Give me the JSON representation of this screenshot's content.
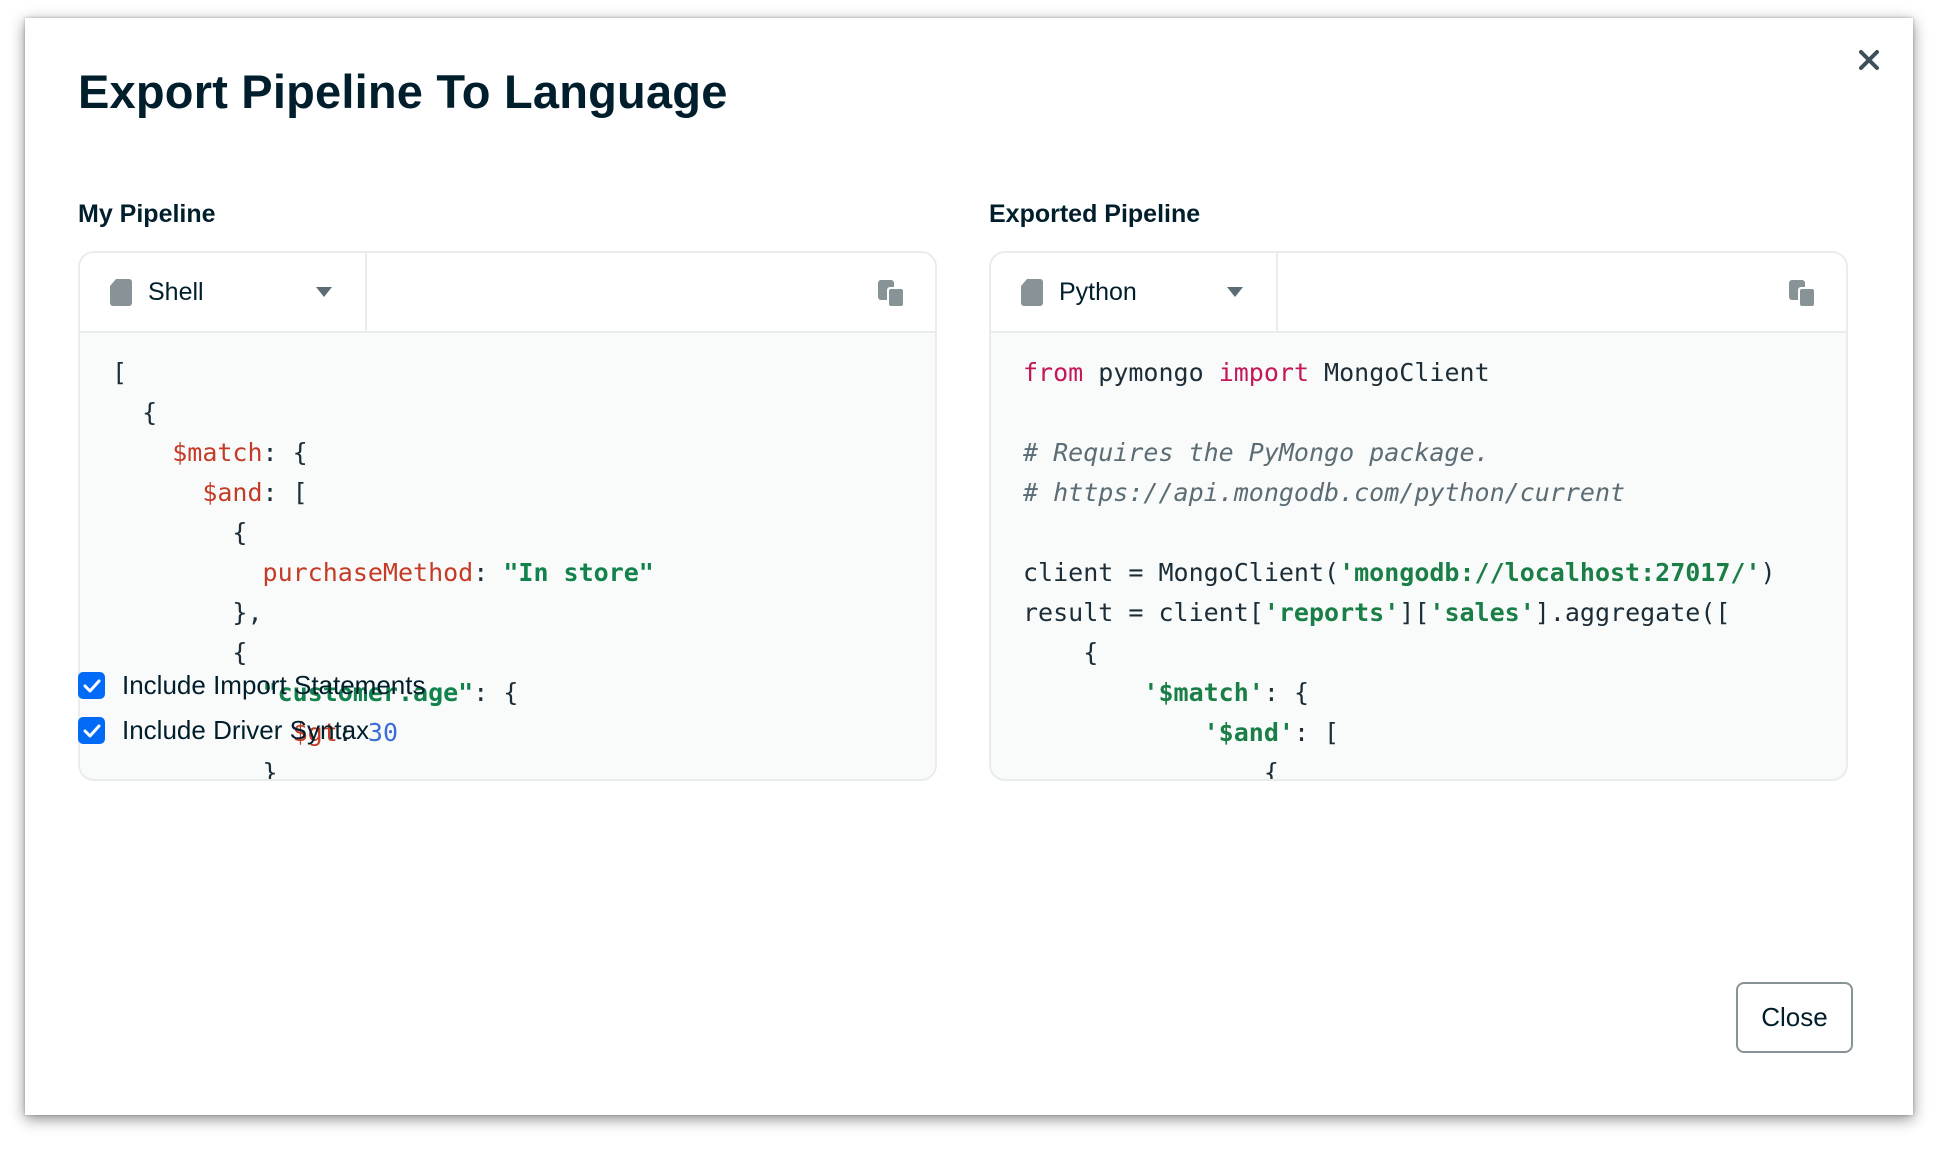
{
  "modal": {
    "title": "Export Pipeline To Language",
    "close_icon": "close-icon"
  },
  "left_panel": {
    "label": "My Pipeline",
    "language": "Shell",
    "file_icon": "file-icon",
    "dropdown_icon": "caret-down-icon",
    "copy_icon": "copy-icon",
    "code_lines": [
      "[",
      "  {",
      "    $match: {",
      "      $and: [",
      "        {",
      "          purchaseMethod: \"In store\"",
      "        },",
      "        {",
      "          \"customer.age\": {",
      "            $gt: 30",
      "          }"
    ]
  },
  "right_panel": {
    "label": "Exported Pipeline",
    "language": "Python",
    "file_icon": "file-icon",
    "dropdown_icon": "caret-down-icon",
    "copy_icon": "copy-icon",
    "code_lines": [
      "from pymongo import MongoClient",
      "",
      "# Requires the PyMongo package.",
      "# https://api.mongodb.com/python/current",
      "",
      "client = MongoClient('mongodb://localhost:27017/')",
      "result = client['reports']['sales'].aggregate([",
      "    {",
      "        '$match': {",
      "            '$and': [",
      "                {"
    ]
  },
  "options": {
    "include_imports": {
      "label": "Include Import Statements",
      "checked": true
    },
    "include_driver": {
      "label": "Include Driver Syntax",
      "checked": true
    }
  },
  "footer": {
    "close_label": "Close"
  },
  "colors": {
    "accent": "#016bf8",
    "text": "#001e2b",
    "key_red": "#c43b28",
    "string_green": "#12824d",
    "number_blue": "#3b6bd6",
    "keyword_pink": "#c2185b"
  }
}
